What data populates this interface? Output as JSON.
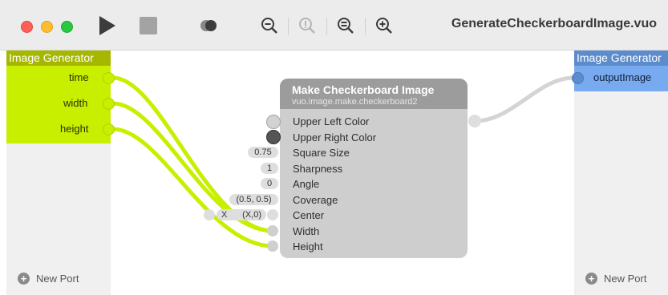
{
  "window": {
    "title": "GenerateCheckerboardImage.vuo"
  },
  "toolbar": {
    "icons": [
      "run-icon",
      "stop-icon",
      "show-events-icon",
      "zoom-out-icon",
      "zoom-actual-icon",
      "zoom-to-fit-icon",
      "zoom-in-icon"
    ]
  },
  "input_publisher": {
    "title": "Image Generator",
    "ports": [
      "time",
      "width",
      "height"
    ],
    "new_port": "New Port",
    "color": "#c8ef00"
  },
  "output_publisher": {
    "title": "Image Generator",
    "ports": [
      "outputImage"
    ],
    "new_port": "New Port",
    "color": "#78aaf0"
  },
  "node": {
    "title": "Make Checkerboard Image",
    "class_name": "vuo.image.make.checkerboard2",
    "ports": [
      {
        "label": "Upper Left Color",
        "value": ""
      },
      {
        "label": "Upper Right Color",
        "value": ""
      },
      {
        "label": "Square Size",
        "value": "0.75"
      },
      {
        "label": "Sharpness",
        "value": "1"
      },
      {
        "label": "Angle",
        "value": "0"
      },
      {
        "label": "Coverage",
        "value": "(0.5, 0.5)"
      },
      {
        "label": "Center",
        "value": "(X,0)"
      },
      {
        "label": "Width",
        "value": ""
      },
      {
        "label": "Height",
        "value": ""
      }
    ],
    "center_drawer_label": "X",
    "upper_left_color": "#d2d2d2",
    "upper_right_color": "#555555"
  }
}
